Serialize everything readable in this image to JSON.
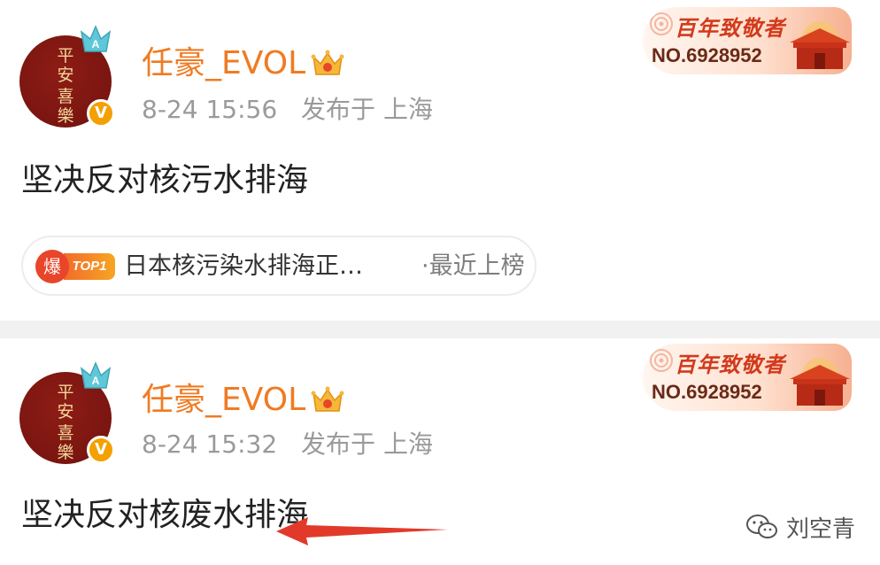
{
  "posts": [
    {
      "avatar_text": [
        "平",
        "安",
        "喜",
        "樂"
      ],
      "vip_badge": "V",
      "username": "任豪_EVOL",
      "timestamp": "8-24 15:56",
      "location": "发布于 上海",
      "fan_badge": {
        "title": "百年致敬者",
        "number": "NO.6928952"
      },
      "content": "坚决反对核污水排海",
      "topic": {
        "hot_label": "爆",
        "rank_label": "TOP1",
        "text": "日本核污染水排海正…",
        "suffix": "·最近上榜"
      }
    },
    {
      "avatar_text": [
        "平",
        "安",
        "喜",
        "樂"
      ],
      "vip_badge": "V",
      "username": "任豪_EVOL",
      "timestamp": "8-24 15:32",
      "location": "发布于 上海",
      "fan_badge": {
        "title": "百年致敬者",
        "number": "NO.6928952"
      },
      "content": "坚决反对核废水排海"
    }
  ],
  "watermark": {
    "text": "刘空青",
    "icon": "wechat-icon"
  },
  "colors": {
    "username": "#f07b22",
    "meta": "#9a9a9a",
    "content": "#222222",
    "arrow": "#e23a2a",
    "avatar": "#7a1510"
  }
}
